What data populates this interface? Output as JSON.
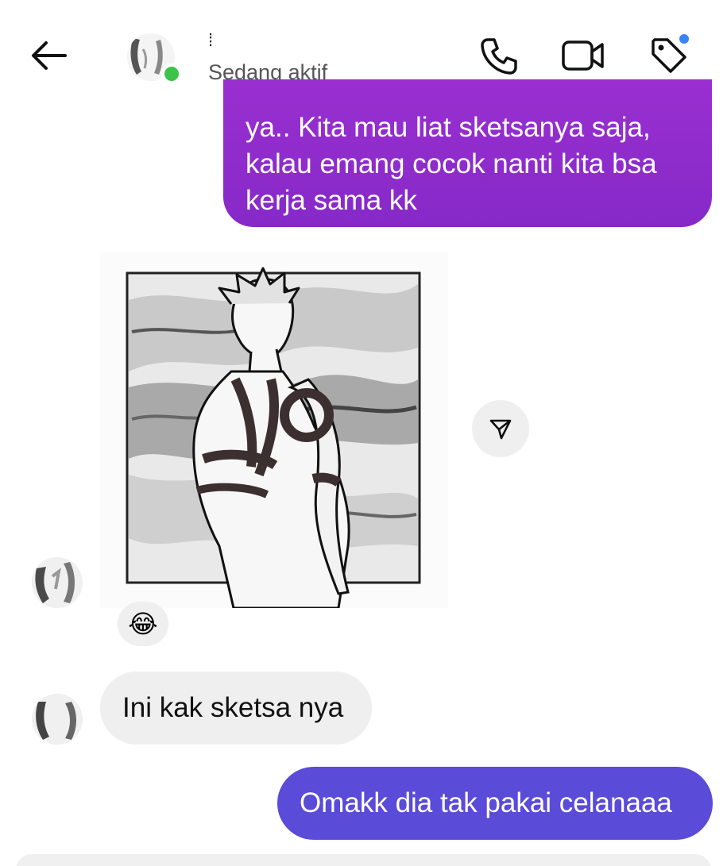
{
  "header": {
    "contact_name": "⁞",
    "status": "Sedang aktif",
    "icons": {
      "back": "arrow-left-icon",
      "call": "phone-icon",
      "video": "video-camera-icon",
      "tag": "tag-icon"
    }
  },
  "messages": [
    {
      "direction": "sent",
      "text_lines": [
        "ya.. Kita mau liat sketsanya saja,",
        "kalau emang cocok nanti kita bsa",
        "kerja sama kk"
      ]
    },
    {
      "direction": "received",
      "type": "image",
      "image": "manga sketch of a tattooed character seen from behind"
    },
    {
      "direction": "received",
      "type": "reaction",
      "emoji": "😂"
    },
    {
      "direction": "received",
      "text": "Ini kak sketsa nya"
    },
    {
      "direction": "sent",
      "text": "Omakk dia tak pakai celanaaa"
    }
  ],
  "colors": {
    "sent_bubble_purple": "#8f2bcc",
    "sent_bubble_indigo": "#5a4bd8",
    "received_bubble": "#efefef",
    "online": "#3cc34a",
    "notification": "#3b82f6"
  }
}
